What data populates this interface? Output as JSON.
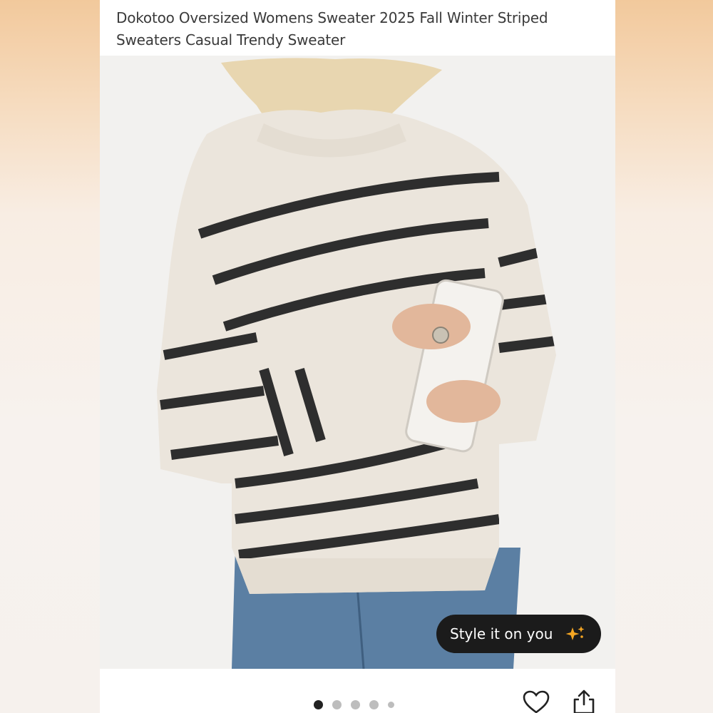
{
  "product": {
    "title": "Dokotoo Oversized Womens Sweater 2025 Fall Winter Striped Sweaters Casual Trendy Sweater"
  },
  "style_button": {
    "label": "Style it on you",
    "icon": "sparkle-icon",
    "accent": "#f5a623"
  },
  "carousel": {
    "total": 5,
    "active_index": 0
  },
  "actions": {
    "like_icon": "heart-icon",
    "share_icon": "share-icon"
  },
  "colors": {
    "sweater": "#ebe5dc",
    "stripe": "#2e2e2e",
    "jeans": "#5b7fa3",
    "pill_bg": "#1b1b1b"
  }
}
